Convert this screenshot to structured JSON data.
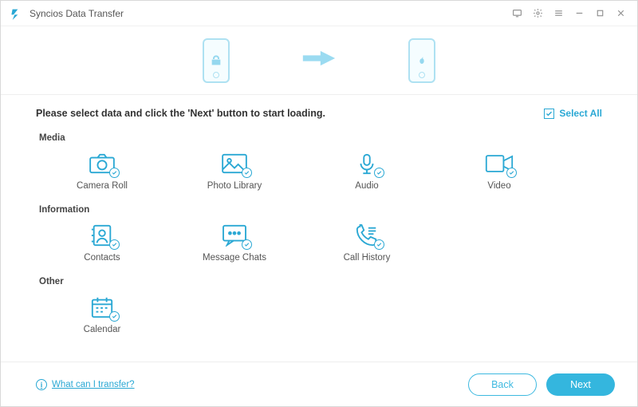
{
  "app": {
    "title": "Syncios Data Transfer"
  },
  "devices": {
    "source": "android",
    "target": "apple"
  },
  "instruction": "Please select data and click the 'Next' button to start loading.",
  "select_all_label": "Select All",
  "sections": {
    "media": {
      "title": "Media",
      "items": [
        "Camera Roll",
        "Photo Library",
        "Audio",
        "Video"
      ]
    },
    "information": {
      "title": "Information",
      "items": [
        "Contacts",
        "Message Chats",
        "Call History"
      ]
    },
    "other": {
      "title": "Other",
      "items": [
        "Calendar"
      ]
    }
  },
  "help_link": "What can I transfer?",
  "buttons": {
    "back": "Back",
    "next": "Next"
  }
}
